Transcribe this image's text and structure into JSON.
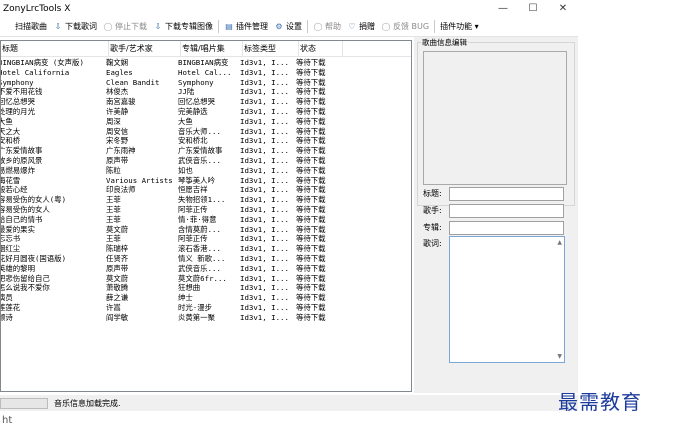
{
  "window": {
    "title": "ZonyLrcTools X",
    "minimize": "—",
    "maximize": "☐",
    "close": "✕"
  },
  "toolbar": [
    {
      "name": "scan-songs-button",
      "label": "扫描歌曲",
      "icon": "folder-icon",
      "glyph": "",
      "disabled": false
    },
    {
      "name": "download-lyrics-button",
      "label": "下载歌词",
      "icon": "download-icon",
      "glyph": "⇩",
      "disabled": false
    },
    {
      "name": "stop-download-button",
      "label": "停止下载",
      "icon": "stop-icon",
      "glyph": "◯",
      "disabled": true
    },
    {
      "name": "download-cover-button",
      "label": "下载专辑图像",
      "icon": "download-icon",
      "glyph": "⇩",
      "disabled": false
    },
    {
      "sep": true
    },
    {
      "name": "plugin-manage-button",
      "label": "插件管理",
      "icon": "plugin-icon",
      "glyph": "▤",
      "disabled": false
    },
    {
      "name": "settings-button",
      "label": "设置",
      "icon": "gear-icon",
      "glyph": "⚙",
      "disabled": false
    },
    {
      "sep": true
    },
    {
      "name": "help-button",
      "label": "帮助",
      "icon": "help-icon",
      "glyph": "◯",
      "disabled": true
    },
    {
      "name": "donate-button",
      "label": "捐赠",
      "icon": "heart-icon",
      "glyph": "♡",
      "disabled": false
    },
    {
      "name": "feedback-button",
      "label": "反馈 BUG",
      "icon": "feedback-icon",
      "glyph": "◯",
      "disabled": true
    },
    {
      "sep": true
    },
    {
      "name": "plugin-functions-menu",
      "label": "插件功能 ▾",
      "icon": "",
      "glyph": "",
      "disabled": false
    }
  ],
  "table": {
    "headers": [
      "标题",
      "歌手/艺术家",
      "专辑/唱片集",
      "标签类型",
      "状态"
    ],
    "rows": [
      [
        "BINGBIAN病变 (女声版)",
        "鞠文娴",
        "BINGBIAN病变",
        "Id3v1, I...",
        "等待下载"
      ],
      [
        "Hotel California",
        "Eagles",
        "Hotel Cal...",
        "Id3v1, I...",
        "等待下载"
      ],
      [
        "Symphony",
        "Clean Bandit",
        "Symphony",
        "Id3v1, I...",
        "等待下载"
      ],
      [
        "不爱不用花钱",
        "林俊杰",
        "JJ陆",
        "Id3v1, I...",
        "等待下载"
      ],
      [
        "回忆总想哭",
        "南宫嘉骏",
        "回忆总想哭",
        "Id3v1, I...",
        "等待下载"
      ],
      [
        "处理的月光",
        "许美静",
        "完美静选",
        "Id3v1, I...",
        "等待下载"
      ],
      [
        "大鱼",
        "周深",
        "大鱼",
        "Id3v1, I...",
        "等待下载"
      ],
      [
        "天之大",
        "周安信",
        "音乐大师...",
        "Id3v1, I...",
        "等待下载"
      ],
      [
        "安和桥",
        "宋冬野",
        "安和桥北",
        "Id3v1, I...",
        "等待下载"
      ],
      [
        "广东爱情故事",
        "广东雨神",
        "广东爱情故事",
        "Id3v1, I...",
        "等待下载"
      ],
      [
        "故乡的原风景",
        "原声带",
        "武侠音乐...",
        "Id3v1, I...",
        "等待下载"
      ],
      [
        "易燃易爆炸",
        "陈粒",
        "如也",
        "Id3v1, I...",
        "等待下载"
      ],
      [
        "梅花雪",
        "Various Artists",
        "琴筝美人吟",
        "Id3v1, I...",
        "等待下载"
      ],
      [
        "般若心经",
        "印良法师",
        "恒愿吉祥",
        "Id3v1, I...",
        "等待下载"
      ],
      [
        "容易受伤的女人(粤)",
        "王菲",
        "失物招领1...",
        "Id3v1, I...",
        "等待下载"
      ],
      [
        "容易受伤的女人",
        "王菲",
        "阿菲正传",
        "Id3v1, I...",
        "等待下载"
      ],
      [
        "给自己的情书",
        "王菲",
        "情·菲·得意",
        "Id3v1, I...",
        "等待下载"
      ],
      [
        "最爱的果实",
        "莫文蔚",
        "含情莫蔚...",
        "Id3v1, I...",
        "等待下载"
      ],
      [
        "忘忘书",
        "王菲",
        "阿菲正传",
        "Id3v1, I...",
        "等待下载"
      ],
      [
        "胭红尘",
        "陈瑞梓",
        "滚石香港...",
        "Id3v1, I...",
        "等待下载"
      ],
      [
        "花好月圆夜(国语版)",
        "任贤齐",
        "情义 新歌...",
        "Id3v1, I...",
        "等待下载"
      ],
      [
        "英雄的黎明",
        "原声带",
        "武侠音乐...",
        "Id3v1, I...",
        "等待下载"
      ],
      [
        "把悲伤留给自己",
        "莫文蔚",
        "莫文蔚6fr...",
        "Id3v1, I...",
        "等待下载"
      ],
      [
        "怎么说我不爱你",
        "萧敬腾",
        "狂想曲",
        "Id3v1, I...",
        "等待下载"
      ],
      [
        "演员",
        "薛之谦",
        "绅士",
        "Id3v1, I...",
        "等待下载"
      ],
      [
        "莲莲花",
        "许嵩",
        "时光·漫步",
        "Id3v1, I...",
        "等待下载"
      ],
      [
        "颤诗",
        "阎学敏",
        "炎黄第一聚",
        "Id3v1, I...",
        "等待下载"
      ]
    ]
  },
  "side": {
    "group_title": "歌曲信息编辑",
    "title_label": "标题:",
    "artist_label": "歌手:",
    "album_label": "专辑:",
    "lyrics_label": "歌词:",
    "scroll_up": "▲",
    "scroll_down": "▼"
  },
  "status": {
    "text": "音乐信息加载完成.",
    "progress": 0
  },
  "watermark": "最需教育",
  "bottom_text": "ht"
}
